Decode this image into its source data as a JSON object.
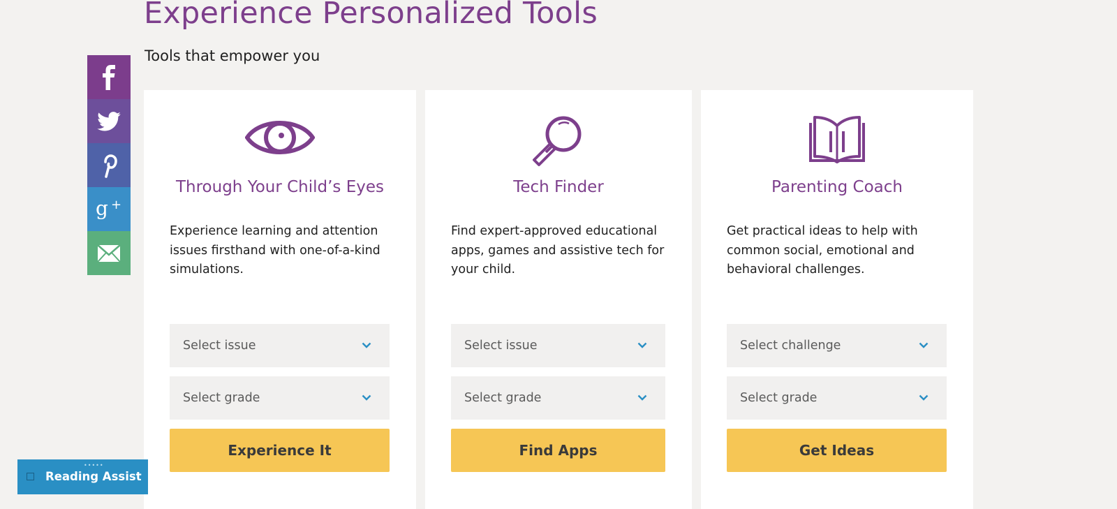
{
  "header": {
    "title": "Experience Personalized Tools",
    "subtitle": "Tools that empower you"
  },
  "share": [
    {
      "name": "facebook",
      "icon": "facebook-icon",
      "color": "#7c3d8c"
    },
    {
      "name": "twitter",
      "icon": "twitter-icon",
      "color": "#6d4f9b"
    },
    {
      "name": "pinterest",
      "icon": "pinterest-icon",
      "color": "#4f62a8"
    },
    {
      "name": "google-plus",
      "icon": "google-plus-icon",
      "color": "#3a8fc8"
    },
    {
      "name": "email",
      "icon": "email-icon",
      "color": "#5baf7d"
    }
  ],
  "cards": [
    {
      "icon": "eye-icon",
      "title": "Through Your Child’s Eyes",
      "description": "Experience learning and attention issues firsthand with one-of-a-kind simulations.",
      "select_1": "Select issue",
      "select_2": "Select grade",
      "button": "Experience It"
    },
    {
      "icon": "magnifying-glass-icon",
      "title": "Tech Finder",
      "description": "Find expert-approved educational apps, games and assistive tech for your child.",
      "select_1": "Select issue",
      "select_2": "Select grade",
      "button": "Find Apps"
    },
    {
      "icon": "book-icon",
      "title": "Parenting Coach",
      "description": "Get practical ideas to help with common social, emotional and behavioral challenges.",
      "select_1": "Select challenge",
      "select_2": "Select grade",
      "button": "Get Ideas"
    }
  ],
  "reading_assist": {
    "label": "Reading Assist",
    "grip": "•••••"
  },
  "colors": {
    "accent": "#7d3f8c",
    "button": "#f6c655",
    "chevron": "#2a8fc4"
  }
}
